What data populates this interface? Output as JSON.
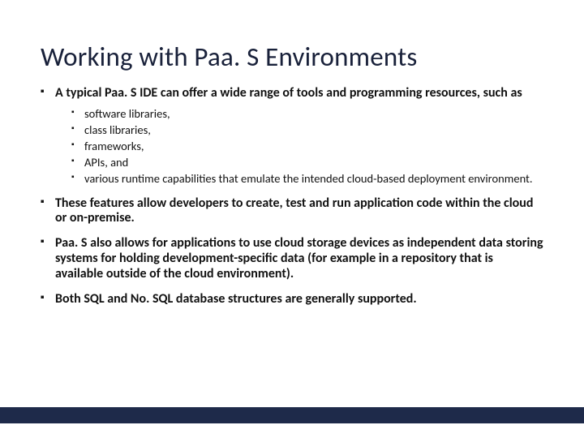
{
  "title": "Working with Paa. S Environments",
  "bullets": {
    "b0": {
      "text": "A typical Paa. S IDE can offer a wide range of tools and programming resources, such as",
      "sub": [
        "software libraries,",
        "class libraries,",
        "frameworks,",
        "APIs, and",
        "various runtime capabilities that emulate the intended cloud-based deployment environment."
      ]
    },
    "b1": "These features allow developers to create, test and run application code within the cloud or on-premise.",
    "b2": "Paa. S also allows for applications to use cloud storage devices as independent data storing systems for holding development-specific data (for example in a repository that is available outside of the cloud environment).",
    "b3": "Both SQL and No. SQL database structures are generally supported."
  }
}
